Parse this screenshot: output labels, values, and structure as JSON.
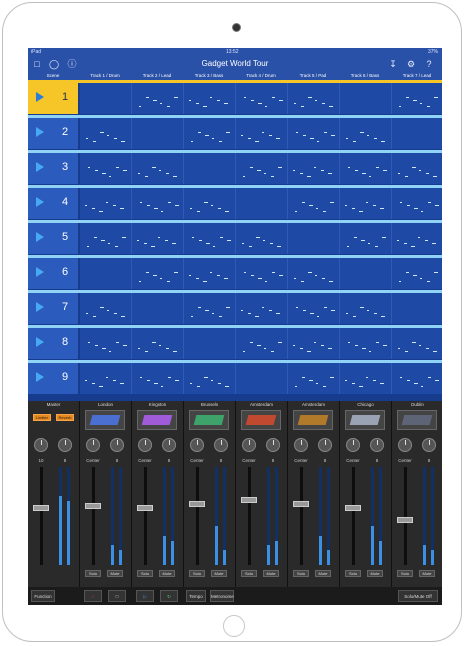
{
  "status": {
    "carrier": "iPad",
    "time": "13:52",
    "battery": "37%"
  },
  "app": {
    "title": "Gadget World Tour"
  },
  "headers": {
    "scene": "Scene",
    "tracks": [
      "Track 1 / Drum",
      "Track 2 / Lead",
      "Track 3 / Bass",
      "Track 4 / Drum",
      "Track 5 / Pad",
      "Track 6 / Bass",
      "Track 7 / Lead"
    ]
  },
  "scenes": [
    "1",
    "2",
    "3",
    "4",
    "5",
    "6",
    "7",
    "8",
    "9"
  ],
  "active_scene": 1,
  "mixer": {
    "master": {
      "label": "Master",
      "limiter": "Limiter",
      "reverb": "Reverb",
      "val1": "10",
      "val2": "8"
    },
    "channels": [
      {
        "label": "London",
        "pan": "Center",
        "send": "8"
      },
      {
        "label": "Kingston",
        "pan": "Center",
        "send": "8"
      },
      {
        "label": "Brussels",
        "pan": "Center",
        "send": "8"
      },
      {
        "label": "Amsterdam",
        "pan": "Center",
        "send": "8"
      },
      {
        "label": "Amsterdam",
        "pan": "Center",
        "send": "8"
      },
      {
        "label": "Chicago",
        "pan": "Center",
        "send": "8"
      },
      {
        "label": "Dublin",
        "pan": "Center",
        "send": "8"
      }
    ],
    "solo": "Solo",
    "mute": "Mute"
  },
  "bottom": {
    "function": "Function",
    "tempo": "Tempo",
    "tempo_value": "Metronome",
    "solo_mute_off": "Solo/Mute Off"
  },
  "colors": {
    "accent": "#f6c628",
    "grid": "#1e4aa5",
    "band": "#8fd3f7"
  }
}
